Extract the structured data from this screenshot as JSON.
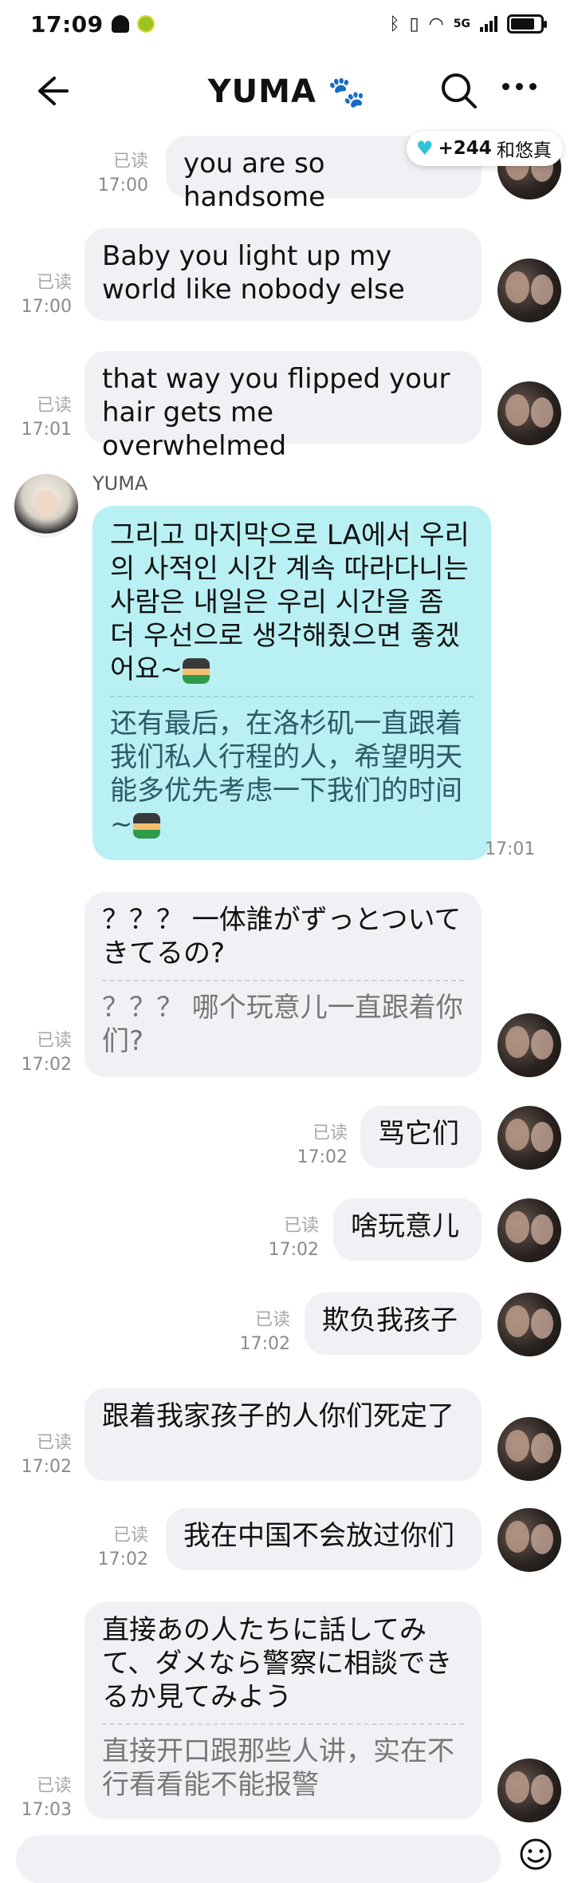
{
  "status": {
    "time": "17:09",
    "network": "5G",
    "battery_percent": 80
  },
  "header": {
    "title": "YUMA",
    "paw_icon": "paw-icon"
  },
  "badge": {
    "count": "+244",
    "text": "和悠真",
    "icon": "heart-icon"
  },
  "messages": [
    {
      "read": "已读",
      "time": "17:00",
      "text": "you are so handsome"
    },
    {
      "read": "已读",
      "time": "17:00",
      "text": "Baby you light up my world like  nobody else"
    },
    {
      "read": "已读",
      "time": "17:01",
      "text": "that way you flipped your hair gets me overwhelmed"
    },
    {
      "sender": "YUMA",
      "time": "17:01",
      "text": "그리고 마지막으로 LA에서 우리의 사적인 시간 계속 따라다니는 사람은 내일은 우리 시간을 좀 더 우선으로 생각해줬으면 좋겠어요~",
      "translation": "还有最后，在洛杉矶一直跟着我们私人行程的人，希望明天能多优先考虑一下我们的时间~"
    },
    {
      "read": "已读",
      "time": "17:02",
      "text": "？？？ 一体誰がずっとついてきてるの?",
      "translation": "？？？ 哪个玩意儿一直跟着你们?"
    },
    {
      "read": "已读",
      "time": "17:02",
      "text": "骂它们"
    },
    {
      "read": "已读",
      "time": "17:02",
      "text": "啥玩意儿"
    },
    {
      "read": "已读",
      "time": "17:02",
      "text": "欺负我孩子"
    },
    {
      "read": "已读",
      "time": "17:02",
      "text": "跟着我家孩子的人你们死定了"
    },
    {
      "read": "已读",
      "time": "17:02",
      "text": "我在中国不会放过你们"
    },
    {
      "read": "已读",
      "time": "17:03",
      "text": "直接あの人たちに話してみて、ダメなら警察に相談できるか見てみよう",
      "translation": "直接开口跟那些人讲，实在不行看看能不能报警"
    }
  ]
}
